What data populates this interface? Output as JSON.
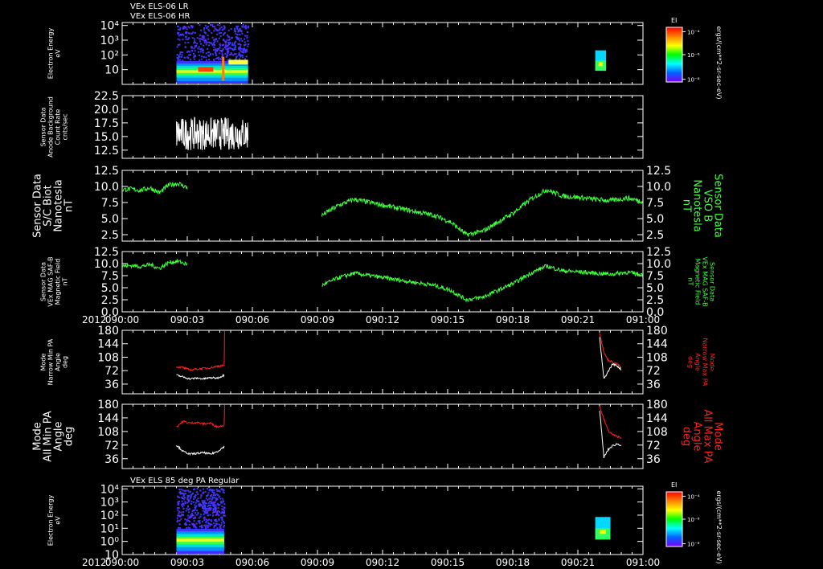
{
  "chart_data": {
    "type": "line",
    "year": "2012",
    "time_ticks": [
      "090:00",
      "090:03",
      "090:06",
      "090:09",
      "090:12",
      "090:15",
      "090:18",
      "090:21",
      "091:00"
    ],
    "panel_titles": {
      "top": [
        "VEx ELS-06 LR",
        "VEx ELS-06 HR"
      ],
      "bottom": [
        "VEx ELS 85 deg PA Regular"
      ]
    },
    "colorbar": {
      "label": "EI",
      "units": "ergs/(cm**2-sr-sec-eV)",
      "ticks": [
        "10⁻⁴",
        "10⁻⁶",
        "10⁻⁸"
      ],
      "colors": [
        "#ff0000",
        "#ff8000",
        "#ffff00",
        "#00ff00",
        "#00ffff",
        "#0060ff",
        "#8000ff"
      ]
    },
    "panels": [
      {
        "type": "heatmap",
        "ylabel_left": [
          "Electron Energy",
          "eV"
        ],
        "yticks": [
          {
            "label": "10⁴",
            "v": 4
          },
          {
            "label": "10³",
            "v": 3
          },
          {
            "label": "10²",
            "v": 2
          },
          {
            "label": "10",
            "v": 1
          }
        ],
        "ylim": [
          0,
          4.2
        ],
        "blocks": [
          {
            "t0": 2.5,
            "t1": 5.8,
            "kind": "lr"
          },
          {
            "t0": 21.8,
            "t1": 22.3,
            "kind": "small"
          }
        ]
      },
      {
        "type": "line",
        "ylabel_left": [
          "Sensor Data",
          "Anode Background",
          "Count Rate",
          "cnts/sec"
        ],
        "yticks": [
          12.5,
          15.0,
          17.5,
          20.0,
          22.5
        ],
        "ylim": [
          11,
          22.5
        ],
        "series": [
          {
            "color": "#ffffff",
            "t0": 2.5,
            "t1": 5.8,
            "min": 12,
            "max": 20,
            "mean": 15.5
          }
        ]
      },
      {
        "type": "line",
        "ylabel_left": [
          "Sensor Data",
          "S/C Biot",
          "Nanotesla",
          "nT"
        ],
        "ylabel_right": [
          "Sensor Data",
          "VSO B",
          "Nanotesla",
          "nT"
        ],
        "yticks": [
          2.5,
          5.0,
          7.5,
          10.0,
          12.5
        ],
        "ytick_labels_right": true,
        "ylim": [
          1.5,
          12.5
        ],
        "series": [
          {
            "color": "#40ff40",
            "t0": 0.0,
            "t1": 3.0,
            "values": [
              9.5,
              9.6,
              9.4,
              9.8,
              9.0,
              10.2,
              10.5,
              9.8
            ]
          },
          {
            "color": "#40ff40",
            "t0": 9.2,
            "t1": 24.0,
            "values": [
              5.5,
              7.0,
              8.0,
              7.5,
              7.0,
              6.5,
              6.0,
              5.5,
              4.5,
              2.5,
              3.0,
              4.5,
              6.0,
              8.0,
              9.5,
              8.5,
              8.3,
              8.0,
              7.8,
              8.2,
              7.7
            ]
          }
        ]
      },
      {
        "type": "line",
        "ylabel_left": [
          "Sensor Data",
          "VEx MAG SAF-B",
          "Magnetic Field",
          "nT"
        ],
        "ylabel_right": [
          "Sensor Data",
          "VEx MAG SAF-B",
          "Magnetic Field",
          "nT"
        ],
        "yticks": [
          0.0,
          2.5,
          5.0,
          7.5,
          10.0,
          12.5
        ],
        "ytick_labels_right": true,
        "ylim": [
          0,
          12.5
        ],
        "series": [
          {
            "color": "#40ff40",
            "t0": 0.0,
            "t1": 3.0,
            "values": [
              9.5,
              9.6,
              9.4,
              9.8,
              9.0,
              10.2,
              10.5,
              9.8
            ]
          },
          {
            "color": "#40ff40",
            "t0": 9.2,
            "t1": 24.0,
            "values": [
              5.5,
              7.0,
              8.0,
              7.5,
              7.0,
              6.5,
              6.0,
              5.5,
              4.5,
              2.5,
              3.0,
              4.5,
              6.0,
              8.0,
              9.5,
              8.5,
              8.3,
              8.0,
              7.8,
              8.2,
              7.7
            ]
          }
        ]
      },
      {
        "type": "line",
        "ylabel_left": [
          "Mode",
          "Narrow Min PA",
          "Angle",
          "deg"
        ],
        "ylabel_right": [
          "Mode",
          "Narrow Max PA",
          "Angle",
          "deg"
        ],
        "right_label_color": "#ff2020",
        "yticks": [
          36,
          72,
          108,
          144,
          180
        ],
        "ytick_labels_right": true,
        "ylim": [
          10,
          180
        ],
        "series": [
          {
            "color": "#ff2020",
            "t0": 2.5,
            "t1": 4.7,
            "values": [
              82,
              80,
              74,
              76,
              78,
              80,
              84,
              86
            ]
          },
          {
            "color": "#ffffff",
            "t0": 2.5,
            "t1": 4.7,
            "values": [
              60,
              55,
              50,
              52,
              50,
              53,
              52,
              60
            ]
          },
          {
            "color": "#ff2020",
            "t0": 4.7,
            "t1": 4.72,
            "values": [
              86,
              178
            ]
          },
          {
            "color": "#ff2020",
            "t0": 22.0,
            "t1": 23.0,
            "values": [
              175,
              120,
              100,
              95,
              90,
              80
            ]
          },
          {
            "color": "#ffffff",
            "t0": 22.0,
            "t1": 23.0,
            "values": [
              160,
              50,
              70,
              90,
              85,
              75
            ]
          }
        ]
      },
      {
        "type": "line",
        "ylabel_left": [
          "Mode",
          "All Min PA",
          "Angle",
          "deg"
        ],
        "ylabel_right": [
          "Mode",
          "All Max PA",
          "Angle",
          "deg"
        ],
        "right_label_color": "#ff2020",
        "yticks": [
          36,
          72,
          108,
          144,
          180
        ],
        "ytick_labels_right": true,
        "ylim": [
          10,
          180
        ],
        "series": [
          {
            "color": "#ff2020",
            "t0": 2.5,
            "t1": 4.7,
            "values": [
              120,
              135,
              130,
              132,
              128,
              130,
              120,
              125
            ]
          },
          {
            "color": "#ffffff",
            "t0": 2.5,
            "t1": 4.7,
            "values": [
              72,
              55,
              48,
              50,
              52,
              48,
              55,
              68
            ]
          },
          {
            "color": "#ff2020",
            "t0": 4.7,
            "t1": 4.72,
            "values": [
              125,
              178
            ]
          },
          {
            "color": "#ff2020",
            "t0": 22.0,
            "t1": 23.0,
            "values": [
              175,
              140,
              110,
              100,
              95,
              92
            ]
          },
          {
            "color": "#ffffff",
            "t0": 22.0,
            "t1": 23.0,
            "values": [
              165,
              40,
              60,
              70,
              75,
              72
            ]
          }
        ]
      },
      {
        "type": "heatmap",
        "ylabel_left": [
          "Electron Energy",
          "eV"
        ],
        "yticks": [
          {
            "label": "10⁴",
            "v": 4
          },
          {
            "label": "10³",
            "v": 3
          },
          {
            "label": "10²",
            "v": 2
          },
          {
            "label": "10¹",
            "v": 1
          },
          {
            "label": "10⁰",
            "v": 0
          },
          {
            "label": "10",
            "v": -1
          }
        ],
        "ylim": [
          -1,
          4.2
        ],
        "blocks": [
          {
            "t0": 2.5,
            "t1": 4.7,
            "kind": "hr"
          },
          {
            "t0": 21.8,
            "t1": 22.5,
            "kind": "small"
          }
        ]
      }
    ]
  }
}
